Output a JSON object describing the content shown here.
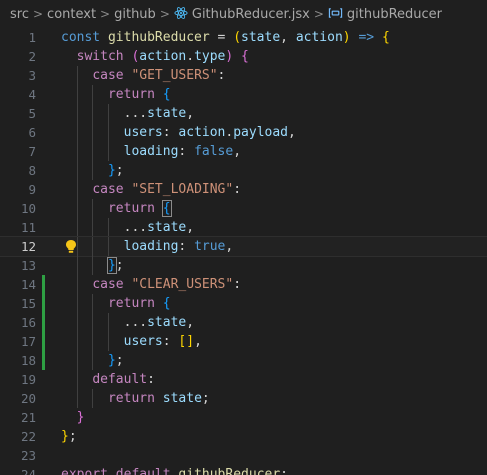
{
  "breadcrumb": {
    "items": [
      "src",
      "context",
      "github",
      "GithubReducer.jsx",
      "githubReducer"
    ],
    "separator": ">"
  },
  "editor": {
    "current_line": 12,
    "lines": [
      {
        "n": "1",
        "tokens": [
          [
            "kw",
            "const"
          ],
          [
            "plain",
            " "
          ],
          [
            "fn",
            "githubReducer"
          ],
          [
            "plain",
            " = "
          ],
          [
            "p1",
            "("
          ],
          [
            "var",
            "state"
          ],
          [
            "plain",
            ", "
          ],
          [
            "var",
            "action"
          ],
          [
            "p1",
            ")"
          ],
          [
            "plain",
            " "
          ],
          [
            "kw",
            "=>"
          ],
          [
            "plain",
            " "
          ],
          [
            "p1",
            "{"
          ]
        ]
      },
      {
        "n": "2",
        "tokens": [
          [
            "plain",
            "  "
          ],
          [
            "ctl",
            "switch"
          ],
          [
            "plain",
            " "
          ],
          [
            "p2",
            "("
          ],
          [
            "var",
            "action"
          ],
          [
            "plain",
            "."
          ],
          [
            "var",
            "type"
          ],
          [
            "p2",
            ")"
          ],
          [
            "plain",
            " "
          ],
          [
            "p2",
            "{"
          ]
        ]
      },
      {
        "n": "3",
        "tokens": [
          [
            "plain",
            "    "
          ],
          [
            "ctl",
            "case"
          ],
          [
            "plain",
            " "
          ],
          [
            "str",
            "\"GET_USERS\""
          ],
          [
            "plain",
            ":"
          ]
        ]
      },
      {
        "n": "4",
        "tokens": [
          [
            "plain",
            "      "
          ],
          [
            "ctl",
            "return"
          ],
          [
            "plain",
            " "
          ],
          [
            "p3",
            "{"
          ]
        ]
      },
      {
        "n": "5",
        "tokens": [
          [
            "plain",
            "        ..."
          ],
          [
            "var",
            "state"
          ],
          [
            "plain",
            ","
          ]
        ]
      },
      {
        "n": "6",
        "tokens": [
          [
            "plain",
            "        "
          ],
          [
            "var",
            "users"
          ],
          [
            "plain",
            ": "
          ],
          [
            "var",
            "action"
          ],
          [
            "plain",
            "."
          ],
          [
            "var",
            "payload"
          ],
          [
            "plain",
            ","
          ]
        ]
      },
      {
        "n": "7",
        "tokens": [
          [
            "plain",
            "        "
          ],
          [
            "var",
            "loading"
          ],
          [
            "plain",
            ": "
          ],
          [
            "bool",
            "false"
          ],
          [
            "plain",
            ","
          ]
        ]
      },
      {
        "n": "8",
        "tokens": [
          [
            "plain",
            "      "
          ],
          [
            "p3",
            "}"
          ],
          [
            "plain",
            ";"
          ]
        ]
      },
      {
        "n": "9",
        "tokens": [
          [
            "plain",
            "    "
          ],
          [
            "ctl",
            "case"
          ],
          [
            "plain",
            " "
          ],
          [
            "str",
            "\"SET_LOADING\""
          ],
          [
            "plain",
            ":"
          ]
        ]
      },
      {
        "n": "10",
        "tokens": [
          [
            "plain",
            "      "
          ],
          [
            "ctl",
            "return"
          ],
          [
            "plain",
            " "
          ],
          [
            "p3m",
            "{"
          ]
        ]
      },
      {
        "n": "11",
        "tokens": [
          [
            "plain",
            "        ..."
          ],
          [
            "var",
            "state"
          ],
          [
            "plain",
            ","
          ]
        ]
      },
      {
        "n": "12",
        "tokens": [
          [
            "plain",
            "        "
          ],
          [
            "var",
            "loading"
          ],
          [
            "plain",
            ": "
          ],
          [
            "bool",
            "true"
          ],
          [
            "plain",
            ","
          ]
        ]
      },
      {
        "n": "13",
        "tokens": [
          [
            "plain",
            "      "
          ],
          [
            "p3m",
            "}"
          ],
          [
            "plain",
            ";"
          ]
        ]
      },
      {
        "n": "14",
        "tokens": [
          [
            "plain",
            "    "
          ],
          [
            "ctl",
            "case"
          ],
          [
            "plain",
            " "
          ],
          [
            "str",
            "\"CLEAR_USERS\""
          ],
          [
            "plain",
            ":"
          ]
        ]
      },
      {
        "n": "15",
        "tokens": [
          [
            "plain",
            "      "
          ],
          [
            "ctl",
            "return"
          ],
          [
            "plain",
            " "
          ],
          [
            "p3",
            "{"
          ]
        ]
      },
      {
        "n": "16",
        "tokens": [
          [
            "plain",
            "        ..."
          ],
          [
            "var",
            "state"
          ],
          [
            "plain",
            ","
          ]
        ]
      },
      {
        "n": "17",
        "tokens": [
          [
            "plain",
            "        "
          ],
          [
            "var",
            "users"
          ],
          [
            "plain",
            ": "
          ],
          [
            "p1",
            "["
          ],
          [
            "p1",
            "]"
          ],
          [
            "plain",
            ","
          ]
        ]
      },
      {
        "n": "18",
        "tokens": [
          [
            "plain",
            "      "
          ],
          [
            "p3",
            "}"
          ],
          [
            "plain",
            ";"
          ]
        ]
      },
      {
        "n": "19",
        "tokens": [
          [
            "plain",
            "    "
          ],
          [
            "ctl",
            "default"
          ],
          [
            "plain",
            ":"
          ]
        ]
      },
      {
        "n": "20",
        "tokens": [
          [
            "plain",
            "      "
          ],
          [
            "ctl",
            "return"
          ],
          [
            "plain",
            " "
          ],
          [
            "var",
            "state"
          ],
          [
            "plain",
            ";"
          ]
        ]
      },
      {
        "n": "21",
        "tokens": [
          [
            "plain",
            "  "
          ],
          [
            "p2",
            "}"
          ]
        ]
      },
      {
        "n": "22",
        "tokens": [
          [
            "p1",
            "}"
          ],
          [
            "plain",
            ";"
          ]
        ]
      },
      {
        "n": "23",
        "tokens": []
      },
      {
        "n": "24",
        "tokens": [
          [
            "ctl",
            "export"
          ],
          [
            "plain",
            " "
          ],
          [
            "ctl",
            "default"
          ],
          [
            "plain",
            " "
          ],
          [
            "fn",
            "githubReducer"
          ],
          [
            "plain",
            ";"
          ]
        ]
      }
    ],
    "diff_added_lines": [
      14,
      15,
      16,
      17,
      18
    ],
    "lightbulb_line": 12
  },
  "colors": {
    "background": "#1f1f1f",
    "diff_added": "#2ea043",
    "lightbulb": "#f5c518"
  },
  "icons": {
    "file": "react-icon",
    "symbol": "symbol-variable-icon",
    "hint": "lightbulb-icon"
  }
}
